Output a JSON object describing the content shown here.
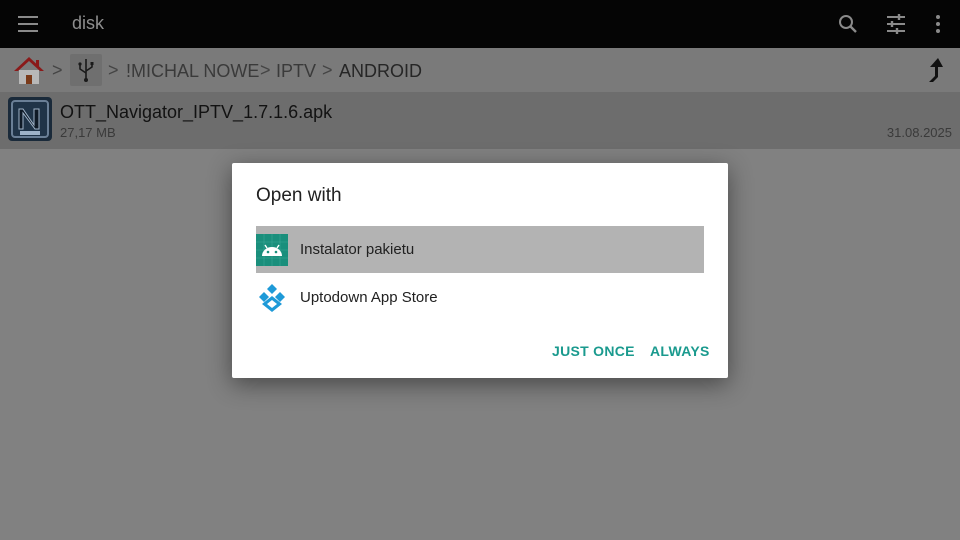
{
  "appbar": {
    "title": "disk",
    "icons": [
      "menu-icon",
      "search-icon",
      "filter-icon",
      "more-vert-icon"
    ]
  },
  "breadcrumb": {
    "icons": [
      "home-icon",
      "usb-icon"
    ],
    "items": [
      "!MICHAL NOWE",
      "IPTV",
      "ANDROID"
    ],
    "separator": ">",
    "up_icon": "up-arrow-icon"
  },
  "file": {
    "name": "OTT_Navigator_IPTV_1.7.1.6.apk",
    "size": "27,17 MB",
    "date": "31.08.2025",
    "icon": "ott-app-icon"
  },
  "dialog": {
    "title": "Open with",
    "options": [
      {
        "label": "Instalator pakietu",
        "icon": "android-icon",
        "selected": true
      },
      {
        "label": "Uptodown App Store",
        "icon": "uptodown-icon",
        "selected": false
      }
    ],
    "buttons": {
      "just_once": "JUST ONCE",
      "always": "ALWAYS"
    }
  },
  "colors": {
    "accent": "#1a9a8e",
    "appbar_bg": "#050505",
    "android_icon_bg": "#1a8f7c",
    "uptodown_blue": "#1ea0e0"
  }
}
